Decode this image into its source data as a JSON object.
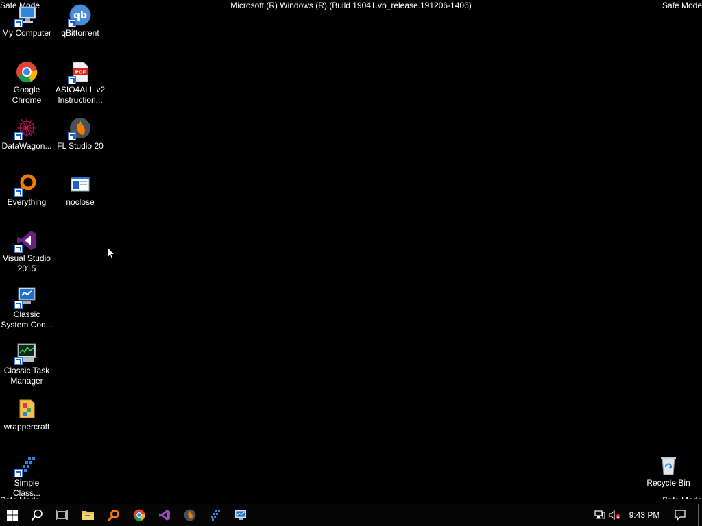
{
  "screen": {
    "safe_mode_label": "Safe Mode",
    "build_title": "Microsoft (R) Windows (R) (Build 19041.vb_release.191206-1406)"
  },
  "desktop_icons": [
    {
      "label": "My Computer",
      "icon": "computer-icon"
    },
    {
      "label": "qBittorrent",
      "icon": "qbittorrent-icon"
    },
    {
      "label": "Google Chrome",
      "icon": "chrome-icon"
    },
    {
      "label": "ASIO4ALL v2 Instruction...",
      "icon": "pdf-icon"
    },
    {
      "label": "DataWagon...",
      "icon": "datawagon-icon"
    },
    {
      "label": "FL Studio 20",
      "icon": "fl-studio-icon"
    },
    {
      "label": "Everything",
      "icon": "everything-icon"
    },
    {
      "label": "noclose",
      "icon": "window-icon"
    },
    {
      "label": "Visual Studio 2015",
      "icon": "visual-studio-icon"
    },
    {
      "label": "Classic System Con...",
      "icon": "control-panel-icon"
    },
    {
      "label": "Classic Task Manager",
      "icon": "task-manager-icon"
    },
    {
      "label": "wrappercraft",
      "icon": "folder-icon"
    },
    {
      "label": "Simple Class...",
      "icon": "simple-class-icon"
    },
    {
      "label": "Recycle Bin",
      "icon": "recycle-bin-icon"
    }
  ],
  "taskbar": {
    "pinned": [
      "start-icon",
      "search-icon",
      "task-view-icon",
      "file-explorer-icon",
      "everything-icon",
      "chrome-icon",
      "visual-studio-icon",
      "fl-studio-icon",
      "app-icon",
      "monitor-icon"
    ],
    "tray": [
      "network-icon",
      "volume-muted-icon"
    ],
    "clock": "9:43 PM",
    "notifications_icon": "action-center-icon"
  },
  "colors": {
    "background": "#000000",
    "text": "#ffffff",
    "taskbar": "#050505"
  }
}
